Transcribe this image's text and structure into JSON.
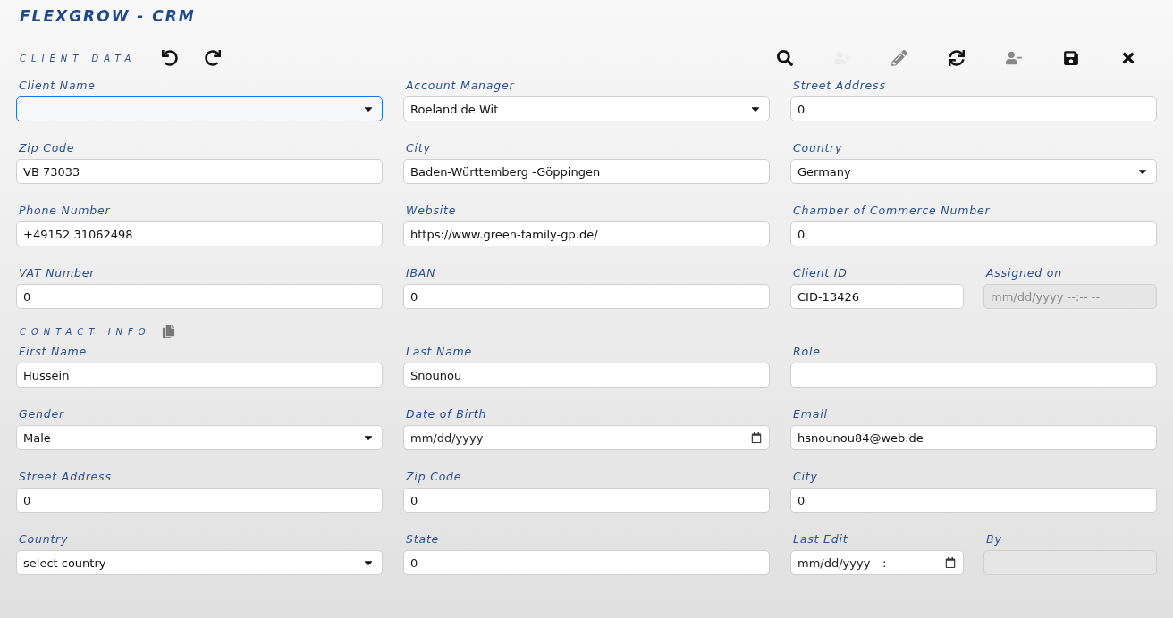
{
  "app_title": "FLEXGROW - CRM",
  "client_section": {
    "heading": "CLIENT DATA",
    "history_actions": [
      {
        "kind": "undo",
        "disabled": false
      },
      {
        "kind": "redo",
        "disabled": false
      }
    ]
  },
  "toolbar": [
    {
      "kind": "search",
      "disabled": false
    },
    {
      "kind": "add-user",
      "disabled": true
    },
    {
      "kind": "edit",
      "disabled": true
    },
    {
      "kind": "refresh",
      "disabled": false
    },
    {
      "kind": "remove-user",
      "disabled": true
    },
    {
      "kind": "save",
      "disabled": false
    },
    {
      "kind": "close",
      "disabled": false
    }
  ],
  "client_rows": [
    [
      {
        "label": "Client Name",
        "kind": "select",
        "focused": true,
        "disabled": false
      },
      {
        "label": "Account Manager",
        "kind": "select",
        "value": "Roeland de Wit",
        "focused": false,
        "disabled": false
      },
      {
        "label": "Street Address",
        "kind": "text",
        "value": "0",
        "focused": false,
        "disabled": false
      }
    ],
    [
      {
        "label": "Zip Code",
        "kind": "text",
        "value": "VB 73033",
        "focused": false,
        "disabled": false
      },
      {
        "label": "City",
        "kind": "text",
        "value": "Baden-Württemberg -Göppingen",
        "focused": false,
        "disabled": false
      },
      {
        "label": "Country",
        "kind": "select",
        "value": "Germany",
        "focused": false,
        "disabled": false
      }
    ],
    [
      {
        "label": "Phone Number",
        "kind": "text",
        "value": "+49152 31062498",
        "focused": false,
        "disabled": false
      },
      {
        "label": "Website",
        "kind": "text",
        "value": "https://www.green-family-gp.de/",
        "focused": false,
        "disabled": false
      },
      {
        "label": "Chamber of Commerce Number",
        "kind": "text",
        "value": "0",
        "focused": false,
        "disabled": false
      }
    ],
    [
      {
        "label": "VAT Number",
        "kind": "text",
        "value": "0",
        "focused": false,
        "disabled": false
      },
      {
        "label": "IBAN",
        "kind": "text",
        "value": "0",
        "focused": false,
        "disabled": false
      },
      {
        "label": "Client ID",
        "kind": "text",
        "value": "CID-13426",
        "focused": false,
        "disabled": false
      },
      {
        "label": "Assigned on",
        "kind": "datetime",
        "placeholder": "mm/dd/yyyy --:-- --",
        "focused": false,
        "disabled": true,
        "calendar_button": false
      }
    ]
  ],
  "contact_section": {
    "heading": "CONTACT INFO"
  },
  "contact_rows": [
    [
      {
        "label": "First Name",
        "kind": "text",
        "value": "Hussein",
        "focused": false,
        "disabled": false
      },
      {
        "label": "Last Name",
        "kind": "text",
        "value": "Snounou",
        "focused": false,
        "disabled": false
      },
      {
        "label": "Role",
        "kind": "text",
        "focused": false,
        "disabled": false
      }
    ],
    [
      {
        "label": "Gender",
        "kind": "select",
        "value": "Male",
        "focused": false,
        "disabled": false
      },
      {
        "label": "Date of Birth",
        "kind": "date",
        "placeholder": "mm/dd/yyyy",
        "focused": false,
        "disabled": false,
        "calendar_button": true
      },
      {
        "label": "Email",
        "kind": "text",
        "value": "hsnounou84@web.de",
        "focused": false,
        "disabled": false
      }
    ],
    [
      {
        "label": "Street Address",
        "kind": "text",
        "value": "0",
        "focused": false,
        "disabled": false
      },
      {
        "label": "Zip Code",
        "kind": "text",
        "value": "0",
        "focused": false,
        "disabled": false
      },
      {
        "label": "City",
        "kind": "text",
        "value": "0",
        "focused": false,
        "disabled": false
      }
    ],
    [
      {
        "label": "Country",
        "kind": "select",
        "value": "select country",
        "focused": false,
        "disabled": false
      },
      {
        "label": "State",
        "kind": "text",
        "value": "0",
        "focused": false,
        "disabled": false
      },
      {
        "label": "Last Edit",
        "kind": "datetime",
        "placeholder": "mm/dd/yyyy --:-- --",
        "focused": false,
        "disabled": false,
        "calendar_button": true
      },
      {
        "label": "By",
        "kind": "text",
        "focused": false,
        "disabled": true
      }
    ]
  ]
}
